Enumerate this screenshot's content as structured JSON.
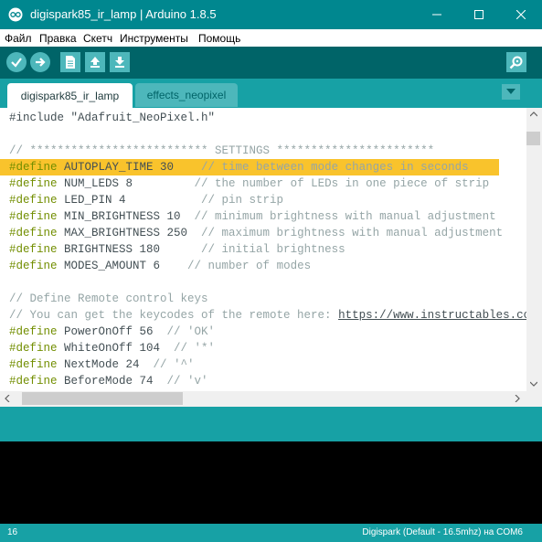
{
  "window": {
    "title": "digispark85_ir_lamp | Arduino 1.8.5",
    "accent": "#00878f"
  },
  "menu": [
    "Файл",
    "Правка",
    "Скетч",
    "Инструменты",
    "Помощь"
  ],
  "toolbar": {
    "buttons": [
      "verify-icon",
      "upload-icon",
      "new-icon",
      "open-icon",
      "save-icon"
    ],
    "serial_monitor": "serial-monitor-icon"
  },
  "tabs": [
    {
      "label": "digispark85_ir_lamp",
      "active": true
    },
    {
      "label": "effects_neopixel",
      "active": false
    }
  ],
  "editor": {
    "highlight_color": "#f9c32c",
    "lines": [
      {
        "text": "#include \"Adafruit_NeoPixel.h\""
      },
      {
        "text": ""
      },
      {
        "text": "// ************************** SETTINGS ***********************"
      },
      {
        "kw": "#define",
        "rest": " AUTOPLAY_TIME 30    ",
        "cm": "// time between mode changes in seconds",
        "highlight": true
      },
      {
        "kw": "#define",
        "rest": " NUM_LEDS 8         ",
        "cm": "// the number of LEDs in one piece of strip"
      },
      {
        "kw": "#define",
        "rest": " LED_PIN 4           ",
        "cm": "// pin strip"
      },
      {
        "kw": "#define",
        "rest": " MIN_BRIGHTNESS 10  ",
        "cm": "// minimum brightness with manual adjustment"
      },
      {
        "kw": "#define",
        "rest": " MAX_BRIGHTNESS 250  ",
        "cm": "// maximum brightness with manual adjustment"
      },
      {
        "kw": "#define",
        "rest": " BRIGHTNESS 180      ",
        "cm": "// initial brightness"
      },
      {
        "kw": "#define",
        "rest": " MODES_AMOUNT 6    ",
        "cm": "// number of modes"
      },
      {
        "text": ""
      },
      {
        "text": "// Define Remote control keys"
      },
      {
        "text": "// You can get the keycodes of the remote here: ",
        "link": "https://www.instructables.com"
      },
      {
        "kw": "#define",
        "rest": " PowerOnOff 56  ",
        "cm": "// 'OK'"
      },
      {
        "kw": "#define",
        "rest": " WhiteOnOff 104  ",
        "cm": "// '*'"
      },
      {
        "kw": "#define",
        "rest": " NextMode 24  ",
        "cm": "// '^'"
      },
      {
        "kw": "#define",
        "rest": " BeforeMode 74  ",
        "cm": "// 'v'"
      }
    ]
  },
  "status": {
    "line": "16",
    "board": "Digispark (Default - 16.5mhz) на COM6"
  }
}
